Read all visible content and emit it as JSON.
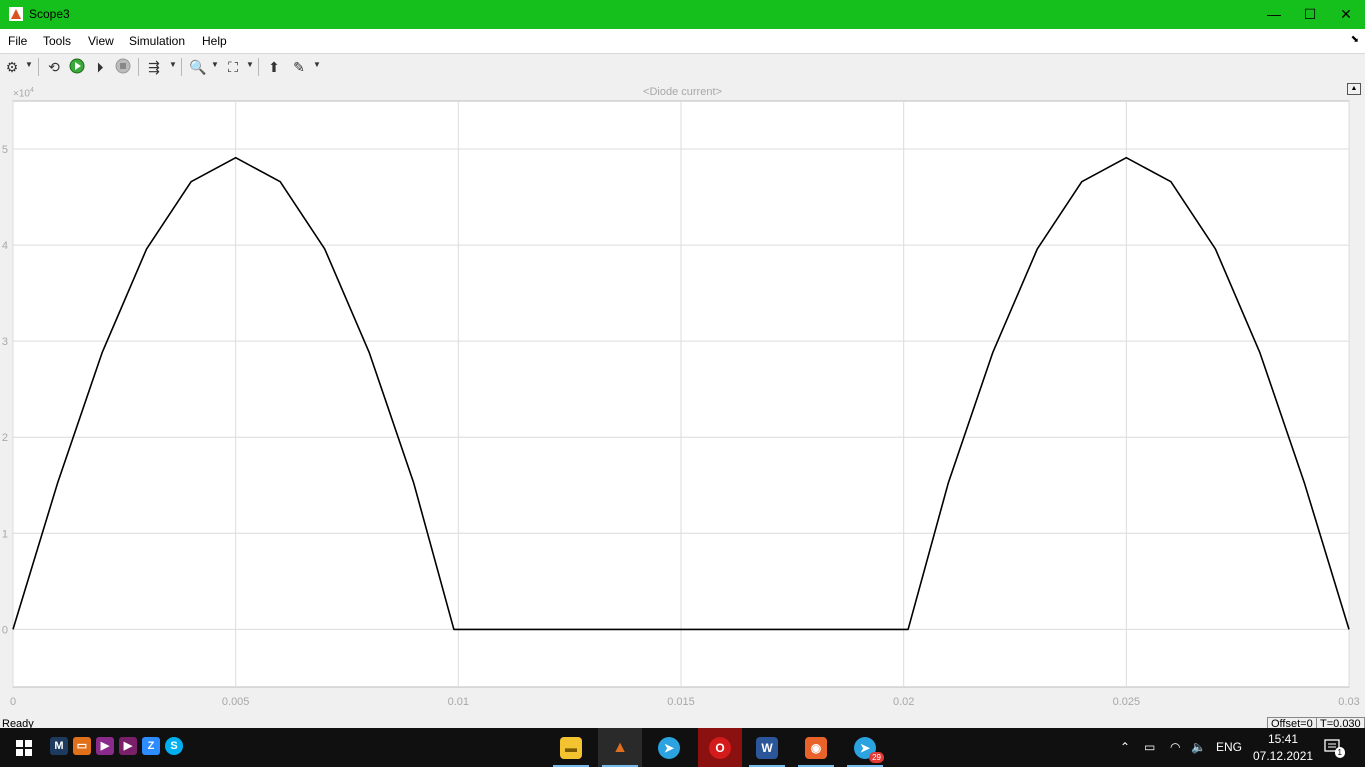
{
  "window": {
    "title": "Scope3",
    "minimize": "—",
    "maximize": "☐",
    "close": "✕",
    "accent": "#16c01c"
  },
  "menu": {
    "items": [
      "File",
      "Tools",
      "View",
      "Simulation",
      "Help"
    ]
  },
  "toolbar": {
    "buttons": [
      "settings-icon",
      "restore-icon",
      "run-icon",
      "step-forward-icon",
      "stop-icon",
      "signal-selector-icon",
      "zoom-icon",
      "fit-to-view-icon",
      "highlight-block-icon",
      "style-icon"
    ]
  },
  "plot": {
    "title": "<Diode current>",
    "exponent_base": "×10",
    "exponent_power": "4",
    "trace_color": "#000000"
  },
  "chart_data": {
    "type": "line",
    "title": "<Diode current>",
    "xlabel": "",
    "ylabel": "",
    "xlim": [
      0,
      0.03
    ],
    "ylim": [
      -0.6,
      5.5
    ],
    "y_scale_multiplier": 10000,
    "grid": true,
    "x_ticks": [
      "0",
      "0.005",
      "0.01",
      "0.015",
      "0.02",
      "0.025",
      "0.03"
    ],
    "y_ticks": [
      "0",
      "1",
      "2",
      "3",
      "4",
      "5"
    ],
    "x": [
      0,
      0.001,
      0.002,
      0.003,
      0.004,
      0.005,
      0.006,
      0.007,
      0.008,
      0.009,
      0.0099,
      0.011,
      0.012,
      0.013,
      0.014,
      0.015,
      0.016,
      0.017,
      0.018,
      0.019,
      0.0201,
      0.021,
      0.022,
      0.023,
      0.024,
      0.025,
      0.026,
      0.027,
      0.028,
      0.029,
      0.03
    ],
    "series": [
      {
        "values": [
          0,
          1.52,
          2.88,
          3.96,
          4.66,
          4.91,
          4.66,
          3.96,
          2.88,
          1.52,
          0,
          0,
          0,
          0,
          0,
          0,
          0,
          0,
          0,
          0,
          0,
          1.52,
          2.88,
          3.96,
          4.66,
          4.91,
          4.66,
          3.96,
          2.88,
          1.52,
          0
        ]
      }
    ]
  },
  "status": {
    "text": "Ready",
    "offset": "Offset=0",
    "time": "T=0.030"
  },
  "taskbar": {
    "tray_left": [
      "M",
      "S",
      "Z"
    ],
    "pinned": [
      "file-explorer-icon",
      "matlab-icon",
      "telegram-icon",
      "opera-icon",
      "word-icon",
      "viewer-icon",
      "telegram-icon"
    ],
    "telegram_badge": "29",
    "language": "ENG",
    "time": "15:41",
    "date": "07.12.2021",
    "notifications": "1"
  }
}
